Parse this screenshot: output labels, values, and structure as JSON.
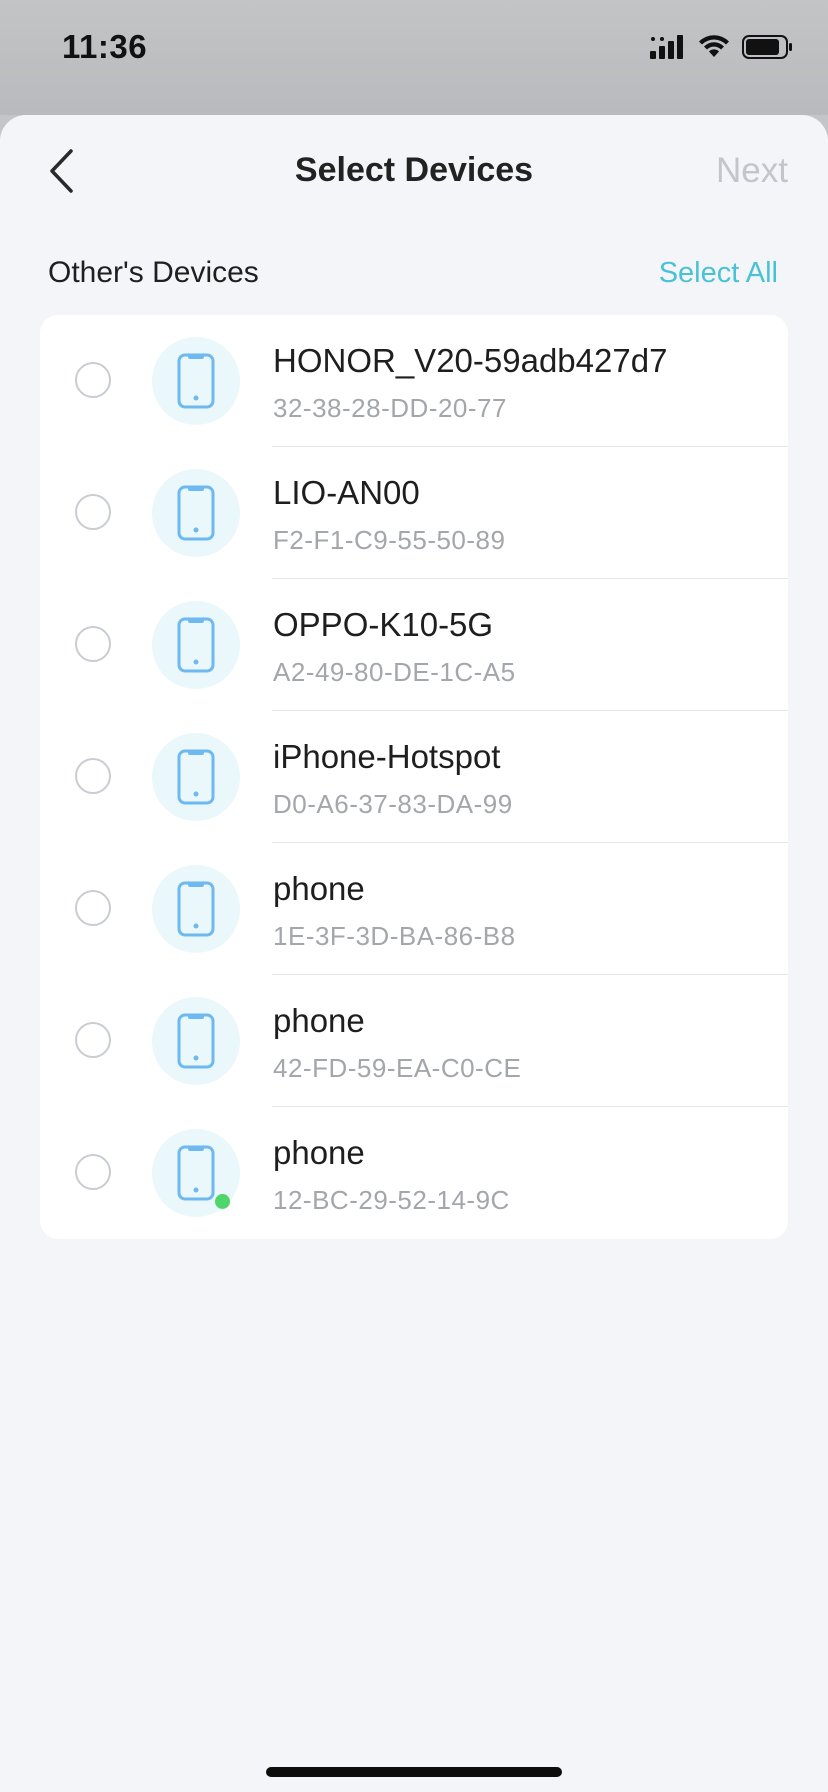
{
  "status_bar": {
    "time": "11:36"
  },
  "header": {
    "title": "Select Devices",
    "next_label": "Next",
    "back_icon": "chevron-left-icon"
  },
  "section": {
    "title": "Other's Devices",
    "select_all_label": "Select All"
  },
  "colors": {
    "accent": "#4ac2d6",
    "disabled": "#c2c5cb",
    "device_icon": "#6fb9f1",
    "online": "#4fd66a",
    "background": "#f3f5f9"
  },
  "devices": [
    {
      "name": "HONOR_V20-59adb427d7",
      "mac": "32-38-28-DD-20-77",
      "online": false,
      "selected": false
    },
    {
      "name": "LIO-AN00",
      "mac": "F2-F1-C9-55-50-89",
      "online": false,
      "selected": false
    },
    {
      "name": "OPPO-K10-5G",
      "mac": "A2-49-80-DE-1C-A5",
      "online": false,
      "selected": false
    },
    {
      "name": "iPhone-Hotspot",
      "mac": "D0-A6-37-83-DA-99",
      "online": false,
      "selected": false
    },
    {
      "name": "phone",
      "mac": "1E-3F-3D-BA-86-B8",
      "online": false,
      "selected": false
    },
    {
      "name": "phone",
      "mac": "42-FD-59-EA-C0-CE",
      "online": false,
      "selected": false
    },
    {
      "name": "phone",
      "mac": "12-BC-29-52-14-9C",
      "online": true,
      "selected": false
    }
  ]
}
